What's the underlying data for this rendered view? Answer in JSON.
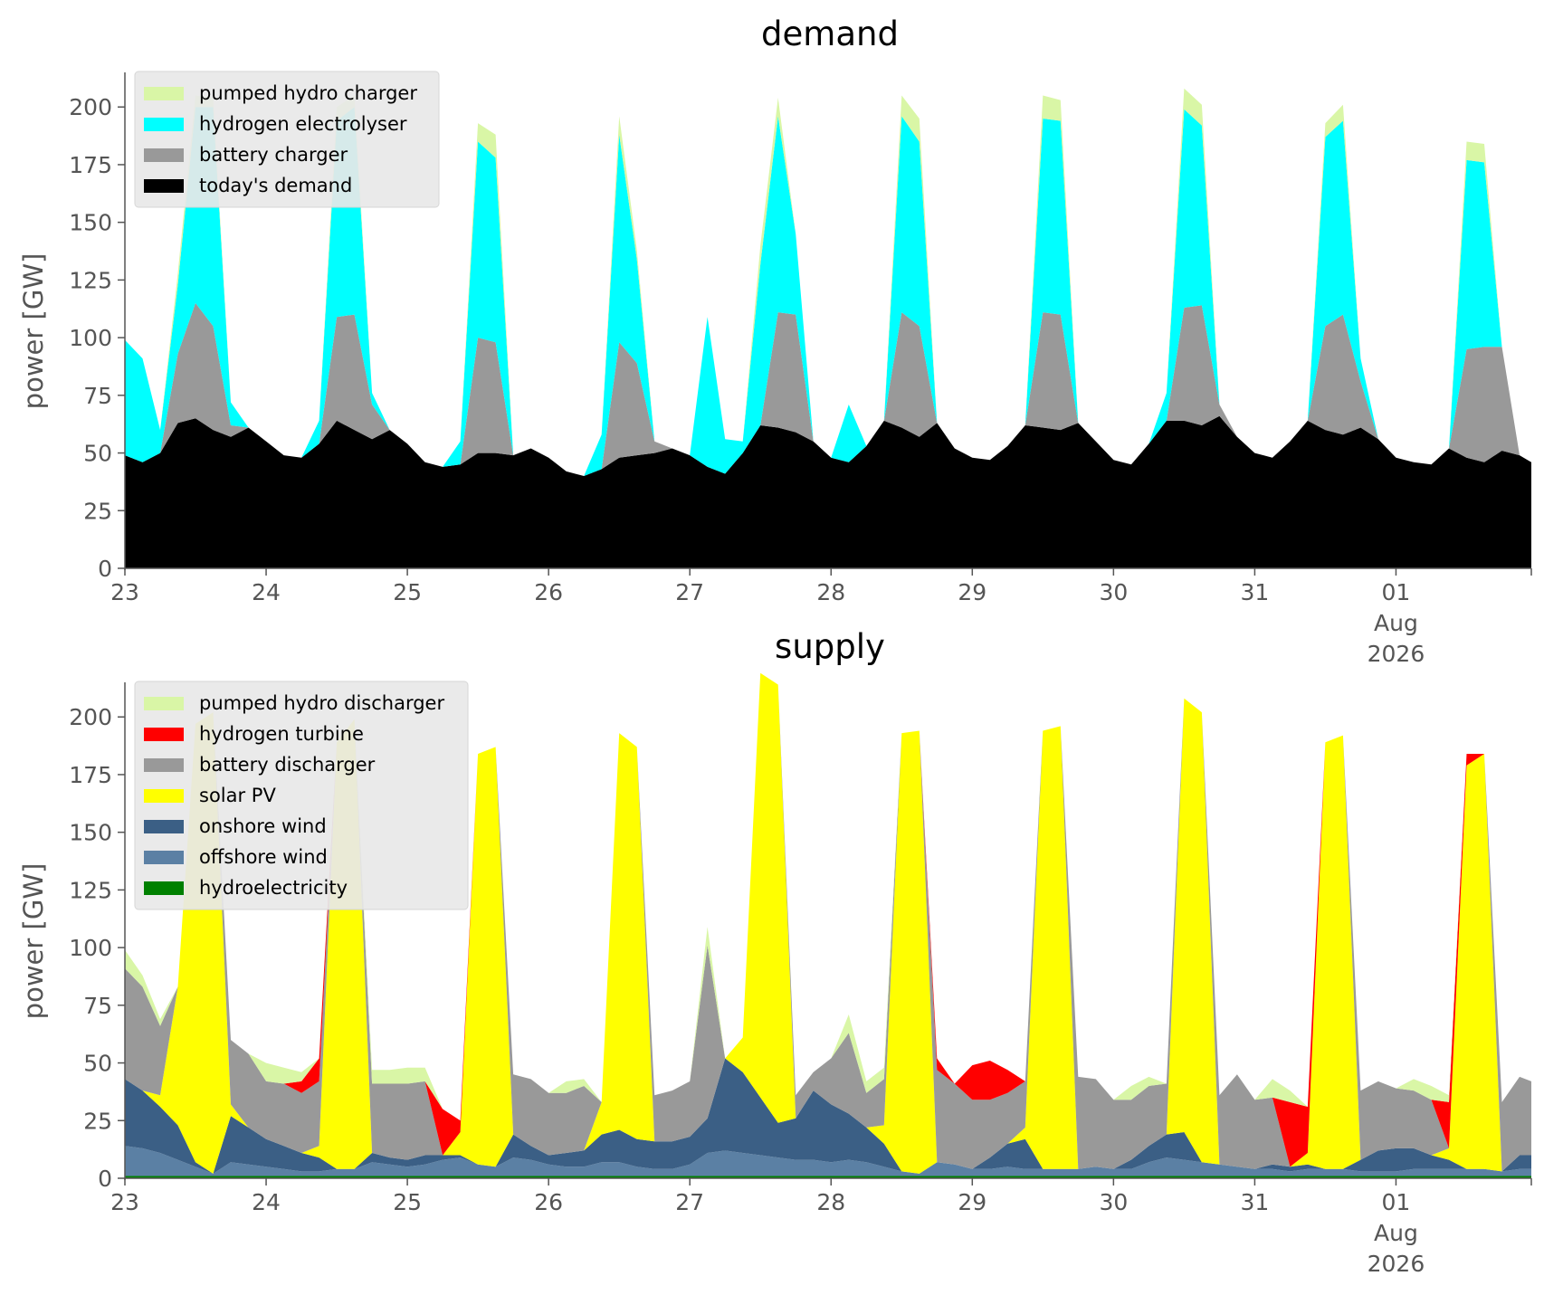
{
  "chart_data": [
    {
      "type": "area",
      "stacked": true,
      "title": "demand",
      "ylabel": "power [GW]",
      "xlabel": "",
      "x_tick_labels": [
        "23",
        "24",
        "25",
        "26",
        "27",
        "28",
        "29",
        "30",
        "31",
        "01\nAug\n2026"
      ],
      "y_ticks": [
        0,
        25,
        50,
        75,
        100,
        125,
        150,
        175,
        200
      ],
      "ylim": [
        0,
        215
      ],
      "xlim": [
        "2026-07-23 00:00",
        "2026-08-01 23:00"
      ],
      "x": [
        "2026-07-23 00:00",
        "2026-07-23 03:00",
        "2026-07-23 06:00",
        "2026-07-23 09:00",
        "2026-07-23 12:00",
        "2026-07-23 15:00",
        "2026-07-23 18:00",
        "2026-07-23 21:00",
        "2026-07-24 00:00",
        "2026-07-24 03:00",
        "2026-07-24 06:00",
        "2026-07-24 09:00",
        "2026-07-24 12:00",
        "2026-07-24 15:00",
        "2026-07-24 18:00",
        "2026-07-24 21:00",
        "2026-07-25 00:00",
        "2026-07-25 03:00",
        "2026-07-25 06:00",
        "2026-07-25 09:00",
        "2026-07-25 12:00",
        "2026-07-25 15:00",
        "2026-07-25 18:00",
        "2026-07-25 21:00",
        "2026-07-26 00:00",
        "2026-07-26 03:00",
        "2026-07-26 06:00",
        "2026-07-26 09:00",
        "2026-07-26 12:00",
        "2026-07-26 15:00",
        "2026-07-26 18:00",
        "2026-07-26 21:00",
        "2026-07-27 00:00",
        "2026-07-27 03:00",
        "2026-07-27 06:00",
        "2026-07-27 09:00",
        "2026-07-27 12:00",
        "2026-07-27 15:00",
        "2026-07-27 18:00",
        "2026-07-27 21:00",
        "2026-07-28 00:00",
        "2026-07-28 03:00",
        "2026-07-28 06:00",
        "2026-07-28 09:00",
        "2026-07-28 12:00",
        "2026-07-28 15:00",
        "2026-07-28 18:00",
        "2026-07-28 21:00",
        "2026-07-29 00:00",
        "2026-07-29 03:00",
        "2026-07-29 06:00",
        "2026-07-29 09:00",
        "2026-07-29 12:00",
        "2026-07-29 15:00",
        "2026-07-29 18:00",
        "2026-07-29 21:00",
        "2026-07-30 00:00",
        "2026-07-30 03:00",
        "2026-07-30 06:00",
        "2026-07-30 09:00",
        "2026-07-30 12:00",
        "2026-07-30 15:00",
        "2026-07-30 18:00",
        "2026-07-30 21:00",
        "2026-07-31 00:00",
        "2026-07-31 03:00",
        "2026-07-31 06:00",
        "2026-07-31 09:00",
        "2026-07-31 12:00",
        "2026-07-31 15:00",
        "2026-07-31 18:00",
        "2026-07-31 21:00",
        "2026-08-01 00:00",
        "2026-08-01 03:00",
        "2026-08-01 06:00",
        "2026-08-01 09:00",
        "2026-08-01 12:00",
        "2026-08-01 15:00",
        "2026-08-01 18:00",
        "2026-08-01 21:00",
        "2026-08-01 23:00"
      ],
      "series": [
        {
          "name": "today's demand",
          "color": "#000000",
          "values": [
            49,
            46,
            50,
            63,
            65,
            60,
            57,
            61,
            55,
            49,
            48,
            54,
            64,
            60,
            56,
            60,
            54,
            46,
            44,
            45,
            50,
            50,
            49,
            52,
            48,
            42,
            40,
            43,
            48,
            49,
            50,
            52,
            49,
            44,
            41,
            50,
            62,
            61,
            59,
            55,
            48,
            46,
            53,
            64,
            61,
            57,
            63,
            52,
            48,
            47,
            53,
            62,
            61,
            60,
            63,
            55,
            47,
            45,
            54,
            64,
            64,
            62,
            66,
            57,
            50,
            48,
            55,
            64,
            60,
            58,
            61,
            56,
            48,
            46,
            45,
            52,
            48,
            46,
            51,
            49,
            46
          ]
        },
        {
          "name": "battery charger",
          "color": "#999999",
          "values": [
            0,
            0,
            0,
            30,
            50,
            45,
            5,
            0,
            0,
            0,
            0,
            0,
            45,
            50,
            15,
            0,
            0,
            0,
            0,
            0,
            50,
            48,
            0,
            0,
            0,
            0,
            0,
            0,
            50,
            40,
            5,
            0,
            0,
            0,
            0,
            0,
            0,
            50,
            51,
            0,
            0,
            0,
            0,
            0,
            50,
            48,
            0,
            0,
            0,
            0,
            0,
            0,
            50,
            50,
            0,
            0,
            0,
            0,
            0,
            0,
            49,
            52,
            5,
            0,
            0,
            0,
            0,
            0,
            45,
            52,
            20,
            0,
            0,
            0,
            0,
            0,
            47,
            50,
            45,
            0,
            0
          ]
        },
        {
          "name": "hydrogen electrolyser",
          "color": "#00ffff",
          "values": [
            50,
            45,
            10,
            30,
            85,
            95,
            10,
            0,
            0,
            0,
            0,
            10,
            85,
            90,
            5,
            0,
            0,
            0,
            0,
            10,
            85,
            80,
            0,
            0,
            0,
            0,
            0,
            15,
            90,
            45,
            0,
            0,
            0,
            65,
            15,
            5,
            70,
            85,
            35,
            0,
            0,
            25,
            0,
            0,
            85,
            80,
            0,
            0,
            0,
            0,
            0,
            0,
            84,
            84,
            0,
            0,
            0,
            0,
            0,
            12,
            86,
            78,
            0,
            0,
            0,
            0,
            0,
            0,
            82,
            84,
            10,
            0,
            0,
            0,
            0,
            0,
            82,
            80,
            0,
            0,
            0
          ]
        },
        {
          "name": "pumped hydro charger",
          "color": "#d9f6a6",
          "values": [
            0,
            0,
            0,
            5,
            5,
            4,
            0,
            0,
            0,
            0,
            0,
            0,
            6,
            5,
            0,
            0,
            0,
            0,
            0,
            0,
            8,
            10,
            0,
            0,
            0,
            0,
            0,
            0,
            8,
            4,
            0,
            0,
            0,
            0,
            0,
            0,
            8,
            8,
            0,
            0,
            0,
            0,
            0,
            0,
            9,
            10,
            0,
            0,
            0,
            0,
            0,
            0,
            10,
            9,
            0,
            0,
            0,
            0,
            0,
            0,
            9,
            9,
            0,
            0,
            0,
            0,
            0,
            0,
            6,
            7,
            0,
            0,
            0,
            0,
            0,
            0,
            8,
            8,
            0,
            0,
            0
          ]
        }
      ],
      "legend_order": [
        "pumped hydro charger",
        "hydrogen electrolyser",
        "battery charger",
        "today's demand"
      ],
      "legend_position": "top-left",
      "grid": false
    },
    {
      "type": "area",
      "stacked": true,
      "title": "supply",
      "ylabel": "power [GW]",
      "xlabel": "",
      "x_tick_labels": [
        "23",
        "24",
        "25",
        "26",
        "27",
        "28",
        "29",
        "30",
        "31",
        "01\nAug\n2026"
      ],
      "y_ticks": [
        0,
        25,
        50,
        75,
        100,
        125,
        150,
        175,
        200
      ],
      "ylim": [
        0,
        215
      ],
      "xlim": [
        "2026-07-23 00:00",
        "2026-08-01 23:00"
      ],
      "x_ref": 0,
      "series": [
        {
          "name": "hydroelectricity",
          "color": "#008000",
          "values": [
            1,
            1,
            1,
            1,
            1,
            1,
            1,
            1,
            1,
            1,
            1,
            1,
            1,
            1,
            1,
            1,
            1,
            1,
            1,
            1,
            1,
            1,
            1,
            1,
            1,
            1,
            1,
            1,
            1,
            1,
            1,
            1,
            1,
            1,
            1,
            1,
            1,
            1,
            1,
            1,
            1,
            1,
            1,
            1,
            1,
            1,
            1,
            1,
            1,
            1,
            1,
            1,
            1,
            1,
            1,
            1,
            1,
            1,
            1,
            1,
            1,
            1,
            1,
            1,
            1,
            1,
            1,
            1,
            1,
            1,
            1,
            1,
            1,
            1,
            1,
            1,
            1,
            1,
            1,
            1,
            1
          ]
        },
        {
          "name": "offshore wind",
          "color": "#5b80a4",
          "values": [
            13,
            12,
            10,
            7,
            4,
            1,
            6,
            5,
            4,
            3,
            2,
            2,
            3,
            3,
            6,
            5,
            4,
            5,
            7,
            8,
            5,
            4,
            8,
            7,
            5,
            4,
            4,
            6,
            6,
            4,
            3,
            3,
            5,
            10,
            11,
            10,
            9,
            8,
            7,
            7,
            6,
            7,
            6,
            4,
            2,
            1,
            6,
            5,
            3,
            3,
            4,
            3,
            3,
            3,
            3,
            4,
            3,
            3,
            6,
            8,
            7,
            6,
            5,
            4,
            3,
            3,
            2,
            3,
            3,
            3,
            2,
            2,
            2,
            3,
            3,
            3,
            3,
            3,
            2,
            3,
            3
          ]
        },
        {
          "name": "onshore wind",
          "color": "#3b5f85",
          "values": [
            29,
            25,
            20,
            15,
            2,
            0,
            20,
            16,
            12,
            10,
            8,
            6,
            0,
            0,
            4,
            3,
            3,
            4,
            2,
            1,
            0,
            0,
            10,
            6,
            4,
            6,
            7,
            12,
            14,
            12,
            12,
            12,
            12,
            15,
            40,
            35,
            25,
            15,
            18,
            30,
            25,
            20,
            15,
            10,
            0,
            0,
            0,
            0,
            0,
            5,
            10,
            13,
            0,
            0,
            0,
            0,
            0,
            4,
            7,
            10,
            12,
            0,
            0,
            0,
            0,
            2,
            2,
            2,
            0,
            0,
            5,
            9,
            10,
            9,
            6,
            4,
            0,
            0,
            0,
            6,
            6
          ]
        },
        {
          "name": "solar PV",
          "color": "#ffff00",
          "values": [
            0,
            0,
            5,
            60,
            190,
            200,
            5,
            0,
            0,
            0,
            0,
            5,
            185,
            195,
            0,
            0,
            0,
            0,
            0,
            10,
            178,
            182,
            0,
            0,
            0,
            0,
            0,
            14,
            172,
            170,
            0,
            0,
            0,
            0,
            0,
            15,
            184,
            190,
            0,
            0,
            0,
            0,
            0,
            8,
            190,
            192,
            0,
            0,
            0,
            0,
            0,
            5,
            190,
            192,
            0,
            0,
            0,
            0,
            0,
            0,
            188,
            195,
            0,
            0,
            0,
            0,
            0,
            5,
            185,
            188,
            0,
            0,
            0,
            0,
            0,
            5,
            175,
            180,
            0,
            0,
            0
          ]
        },
        {
          "name": "battery discharger",
          "color": "#999999",
          "values": [
            48,
            45,
            30,
            0,
            0,
            0,
            28,
            32,
            25,
            27,
            26,
            28,
            0,
            0,
            30,
            32,
            33,
            32,
            0,
            0,
            0,
            0,
            26,
            29,
            27,
            26,
            28,
            0,
            0,
            0,
            20,
            22,
            24,
            75,
            0,
            0,
            0,
            0,
            10,
            8,
            20,
            35,
            15,
            20,
            0,
            0,
            40,
            35,
            30,
            25,
            22,
            20,
            0,
            0,
            40,
            38,
            30,
            26,
            26,
            22,
            0,
            0,
            30,
            40,
            30,
            29,
            0,
            0,
            0,
            0,
            30,
            30,
            26,
            25,
            24,
            0,
            0,
            0,
            30,
            34,
            32
          ]
        },
        {
          "name": "hydrogen turbine",
          "color": "#ff0000",
          "values": [
            0,
            0,
            0,
            0,
            0,
            0,
            0,
            0,
            0,
            0,
            5,
            10,
            0,
            0,
            0,
            0,
            0,
            0,
            20,
            5,
            0,
            0,
            0,
            0,
            0,
            0,
            0,
            0,
            0,
            0,
            0,
            0,
            0,
            0,
            0,
            0,
            0,
            0,
            0,
            0,
            0,
            0,
            0,
            0,
            0,
            0,
            5,
            0,
            15,
            17,
            10,
            0,
            0,
            0,
            0,
            0,
            0,
            0,
            0,
            0,
            0,
            0,
            0,
            0,
            0,
            0,
            28,
            20,
            0,
            0,
            0,
            0,
            0,
            0,
            0,
            20,
            5,
            0,
            0,
            0,
            0
          ]
        },
        {
          "name": "pumped hydro discharger",
          "color": "#d9f6a6",
          "values": [
            8,
            5,
            3,
            0,
            0,
            0,
            0,
            0,
            8,
            7,
            4,
            0,
            0,
            0,
            6,
            6,
            7,
            6,
            0,
            0,
            0,
            0,
            0,
            0,
            0,
            5,
            3,
            0,
            0,
            0,
            0,
            0,
            0,
            8,
            0,
            0,
            0,
            0,
            0,
            0,
            0,
            8,
            5,
            5,
            0,
            0,
            0,
            0,
            0,
            0,
            0,
            0,
            0,
            0,
            0,
            0,
            0,
            6,
            4,
            0,
            0,
            0,
            0,
            0,
            0,
            8,
            5,
            0,
            0,
            0,
            0,
            0,
            0,
            5,
            6,
            3,
            0,
            0,
            0,
            0,
            0
          ]
        }
      ],
      "legend_order": [
        "pumped hydro discharger",
        "hydrogen turbine",
        "battery discharger",
        "solar PV",
        "onshore wind",
        "offshore wind",
        "hydroelectricity"
      ],
      "legend_position": "top-left",
      "grid": false
    }
  ]
}
